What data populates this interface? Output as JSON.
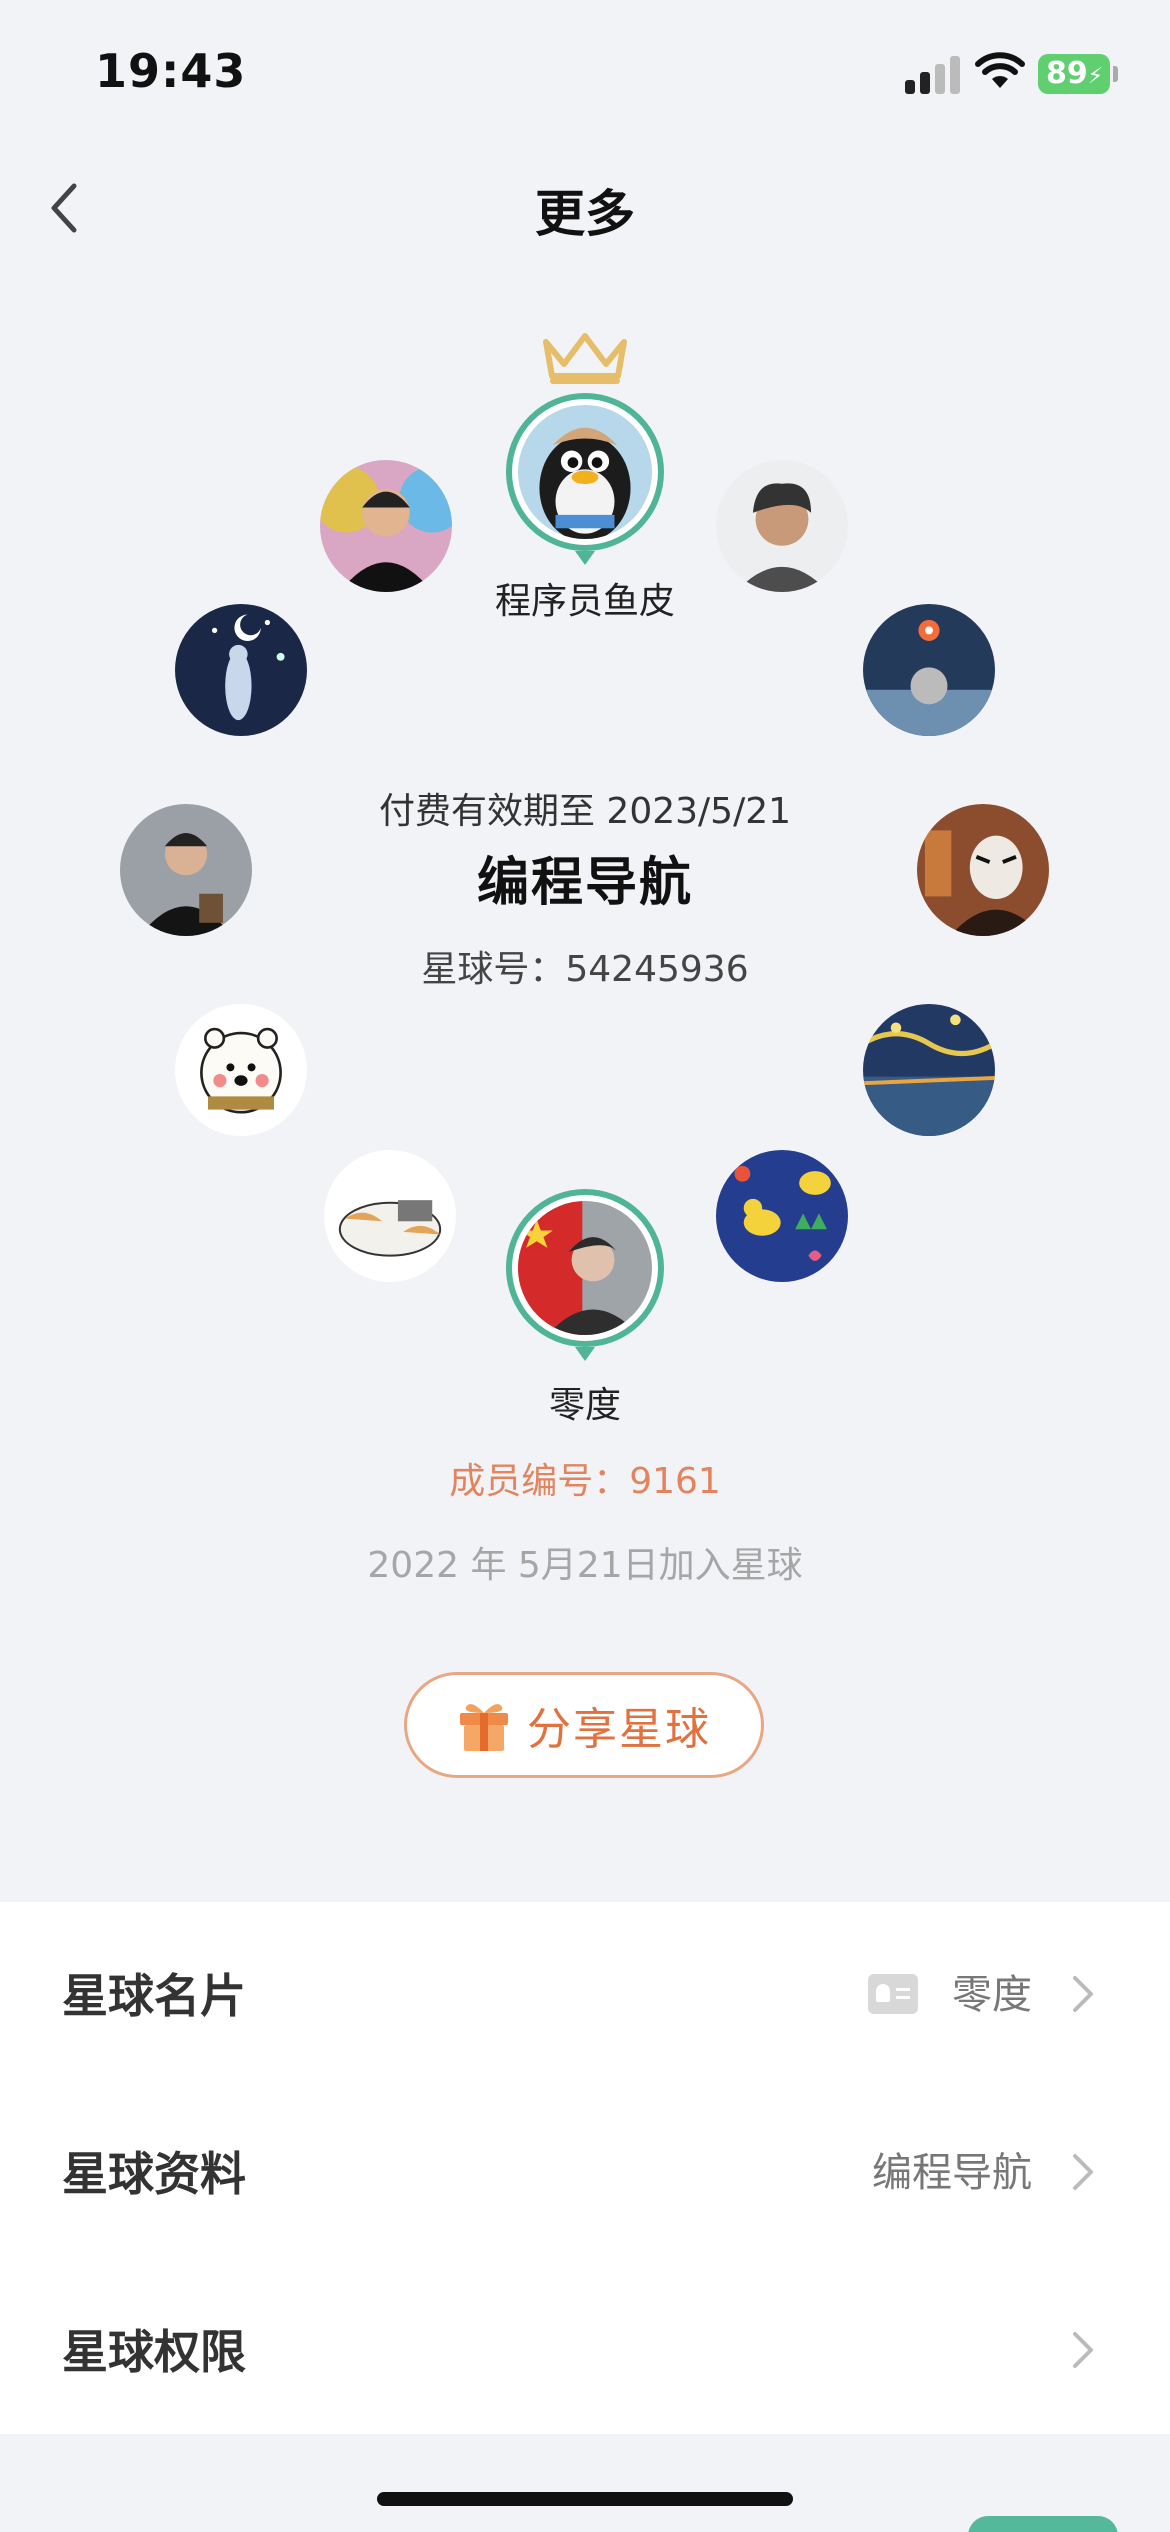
{
  "status_bar": {
    "time": "19:43",
    "battery": "89"
  },
  "nav": {
    "title": "更多"
  },
  "colors": {
    "accent_green": "#4fb596",
    "accent_orange": "#e1713f",
    "crown_gold": "#e6bd68"
  },
  "owner": {
    "name": "程序员鱼皮"
  },
  "planet": {
    "paid_until": "付费有效期至 2023/5/21",
    "name": "编程导航",
    "id_text": "星球号：54245936"
  },
  "member": {
    "name": "零度",
    "number_text": "成员编号：9161",
    "join_text": "2022 年 5月21日加入星球"
  },
  "share_button": {
    "label": "分享星球",
    "icon": "gift-icon"
  },
  "menu": [
    {
      "label": "星球名片",
      "value": "零度",
      "icon": "id-card-icon"
    },
    {
      "label": "星球资料",
      "value": "编程导航"
    },
    {
      "label": "星球权限",
      "value": ""
    }
  ]
}
